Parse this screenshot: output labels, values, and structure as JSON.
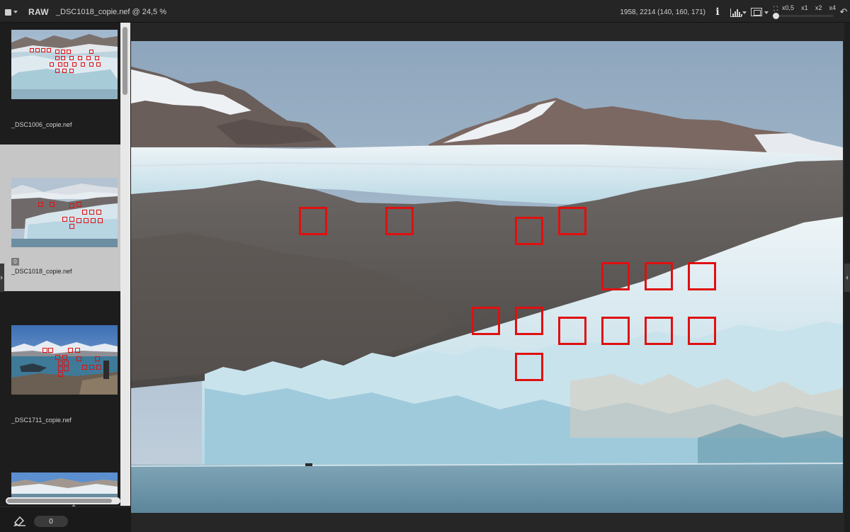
{
  "toolbar": {
    "stack_icon": "stack-square-icon",
    "raw_label": "RAW",
    "file_title": "_DSC1018_copie.nef @ 24,5 %",
    "pixel_readout": "1958, 2214 (140, 160, 171)",
    "info_label": "i",
    "zoom_fit_label": "⛶",
    "zoom_levels": [
      "x0,5",
      "x1",
      "x2",
      "x4"
    ],
    "undo_label": "↶"
  },
  "filmstrip": {
    "items": [
      {
        "filename": "_DSC1006_copie.nef",
        "selected": false
      },
      {
        "filename": "_DSC1018_copie.nef",
        "selected": true,
        "rating": "0"
      },
      {
        "filename": "_DSC1711_copie.nef",
        "selected": false
      },
      {
        "filename": "",
        "selected": false
      }
    ],
    "counter_value": "0"
  },
  "colors": {
    "af_point": "#e01010",
    "selection_bg": "#c6c6c6"
  }
}
